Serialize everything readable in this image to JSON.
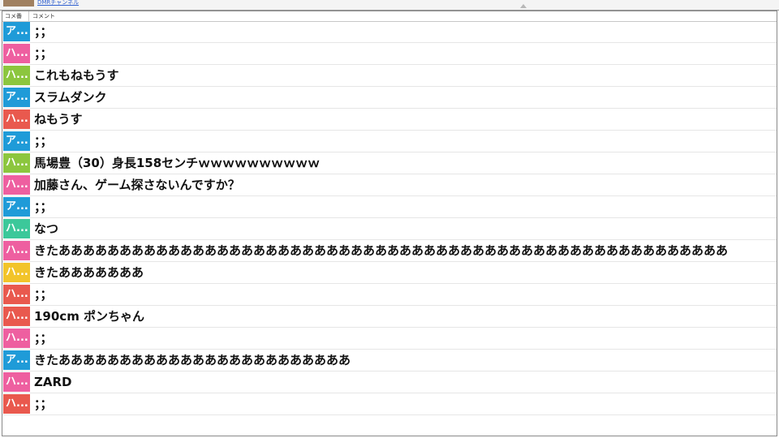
{
  "top": {
    "channel_link": "DMRチャンネル"
  },
  "table": {
    "headers": {
      "number": "コメ番",
      "comment": "コメント"
    },
    "rows": [
      {
        "badge": "ア...",
        "color": "#1f9bd8",
        "text": "；；"
      },
      {
        "badge": "ハ...",
        "color": "#ee5fa0",
        "text": "；；"
      },
      {
        "badge": "ハ...",
        "color": "#8cc63e",
        "text": "これもねもうす"
      },
      {
        "badge": "ア...",
        "color": "#1f9bd8",
        "text": "スラムダンク"
      },
      {
        "badge": "ハ...",
        "color": "#e9594e",
        "text": "ねもうす"
      },
      {
        "badge": "ア...",
        "color": "#1f9bd8",
        "text": "；；"
      },
      {
        "badge": "ハ...",
        "color": "#8cc63e",
        "text": "馬場豊（30）身長158センチｗｗｗｗｗｗｗｗｗｗ"
      },
      {
        "badge": "ハ...",
        "color": "#ee5fa0",
        "text": "加藤さん、ゲーム探さないんですか？"
      },
      {
        "badge": "ア...",
        "color": "#1f9bd8",
        "text": "；；"
      },
      {
        "badge": "ハ...",
        "color": "#3cc89a",
        "text": "なつ"
      },
      {
        "badge": "ハ...",
        "color": "#ee5fa0",
        "text": "きたあああああああああああああああああああああああああああああああああああああああああああああああああああああああ"
      },
      {
        "badge": "ハ...",
        "color": "#f2c42a",
        "text": "きたあああああああ"
      },
      {
        "badge": "ハ...",
        "color": "#e9594e",
        "text": "；；"
      },
      {
        "badge": "ハ...",
        "color": "#e9594e",
        "text": "190cm ポンちゃん"
      },
      {
        "badge": "ハ...",
        "color": "#ee5fa0",
        "text": "；；"
      },
      {
        "badge": "ア...",
        "color": "#1f9bd8",
        "text": "きたああああああああああああああああああああああああ"
      },
      {
        "badge": "ハ...",
        "color": "#ee5fa0",
        "text": "ZARD"
      },
      {
        "badge": "ハ...",
        "color": "#e9594e",
        "text": "；；"
      }
    ]
  }
}
